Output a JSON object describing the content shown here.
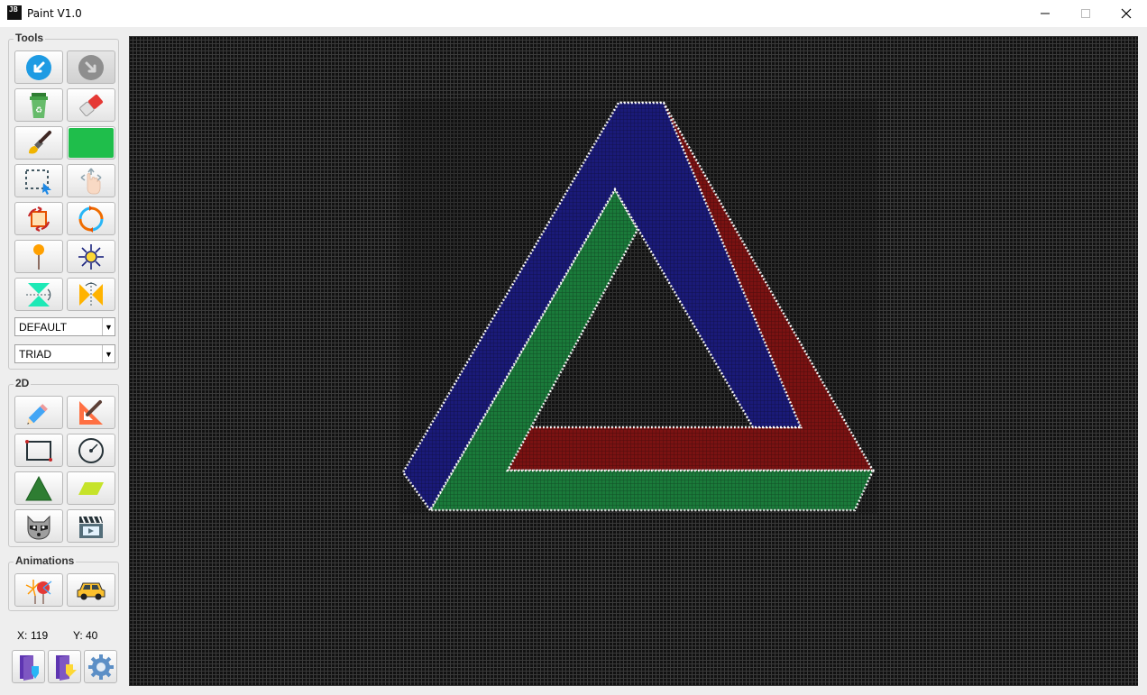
{
  "window": {
    "app_icon_text": "JB",
    "title": "Paint V1.0",
    "controls": {
      "minimize_glyph": "—",
      "maximize_glyph": "☐",
      "close_glyph": "✕"
    }
  },
  "tools_group": {
    "label": "Tools",
    "buttons": [
      {
        "name": "undo",
        "icon": "undo-icon"
      },
      {
        "name": "redo",
        "icon": "redo-icon"
      },
      {
        "name": "clear",
        "icon": "recycle-bin-icon"
      },
      {
        "name": "eraser",
        "icon": "eraser-icon"
      },
      {
        "name": "fill",
        "icon": "paint-brush-icon"
      },
      {
        "name": "color",
        "icon": "color-swatch",
        "color": "#1fbe4b"
      },
      {
        "name": "select",
        "icon": "selection-icon"
      },
      {
        "name": "move",
        "icon": "hand-move-icon"
      },
      {
        "name": "rotate",
        "icon": "rotate-square-icon"
      },
      {
        "name": "rotate-circle",
        "icon": "rotate-circle-icon"
      },
      {
        "name": "pin",
        "icon": "pin-icon"
      },
      {
        "name": "scale",
        "icon": "scale-burst-icon"
      },
      {
        "name": "flip-vertical",
        "icon": "flip-vertical-icon"
      },
      {
        "name": "flip-horizontal",
        "icon": "flip-horizontal-icon"
      }
    ],
    "select_mode": {
      "value": "DEFAULT"
    },
    "select_palette": {
      "value": "TRIAD"
    }
  },
  "group_2d": {
    "label": "2D",
    "buttons": [
      {
        "name": "pencil",
        "icon": "pencil-icon"
      },
      {
        "name": "line",
        "icon": "ruler-pencil-icon"
      },
      {
        "name": "rectangle",
        "icon": "rectangle-icon"
      },
      {
        "name": "circle",
        "icon": "circle-icon"
      },
      {
        "name": "triangle",
        "icon": "triangle-icon"
      },
      {
        "name": "parallelogram",
        "icon": "parallelogram-icon"
      },
      {
        "name": "raccoon",
        "icon": "raccoon-icon"
      },
      {
        "name": "clapper",
        "icon": "clapperboard-icon"
      }
    ]
  },
  "animations_group": {
    "label": "Animations",
    "buttons": [
      {
        "name": "fireworks",
        "icon": "fireworks-icon"
      },
      {
        "name": "car",
        "icon": "car-icon"
      }
    ]
  },
  "status": {
    "x_label": "X:",
    "x_value": "119",
    "y_label": "Y:",
    "y_value": "40"
  },
  "footer_buttons": [
    {
      "name": "open",
      "icon": "open-file-icon"
    },
    {
      "name": "save",
      "icon": "save-file-icon"
    },
    {
      "name": "settings",
      "icon": "gear-icon"
    }
  ],
  "canvas": {
    "background": "#111111",
    "grid_color": "#3a3a3a",
    "drawing": "impossible-triangle",
    "colors": {
      "blue": "#1a1a78",
      "red": "#7a1212",
      "green": "#1a7a3a",
      "outline": "#ffffff"
    }
  }
}
